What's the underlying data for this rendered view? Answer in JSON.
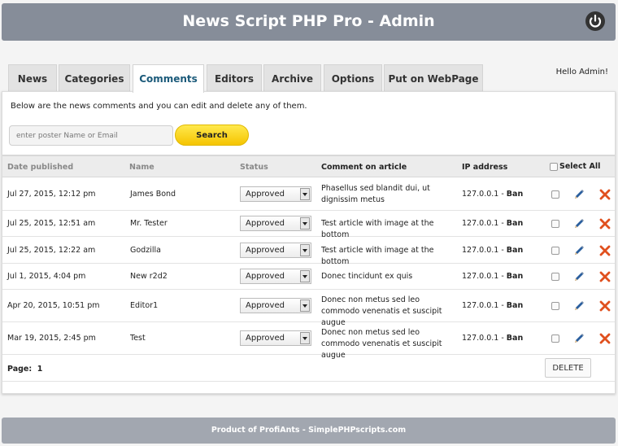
{
  "header": {
    "title": "News Script PHP Pro - Admin",
    "power_icon": "power-icon"
  },
  "tabs": [
    {
      "label": "News",
      "active": false
    },
    {
      "label": "Categories",
      "active": false
    },
    {
      "label": "Comments",
      "active": true
    },
    {
      "label": "Editors",
      "active": false
    },
    {
      "label": "Archive",
      "active": false
    },
    {
      "label": "Options",
      "active": false
    },
    {
      "label": "Put on WebPage",
      "active": false
    }
  ],
  "hello": "Hello Admin!",
  "intro": "Below are the news comments and you can edit and delete any of them.",
  "search": {
    "placeholder": "enter poster Name or Email",
    "button": "Search"
  },
  "table": {
    "headers": {
      "date": "Date published",
      "name": "Name",
      "status": "Status",
      "comment": "Comment on article",
      "ip": "IP address",
      "select_all": "Select All"
    },
    "rows": [
      {
        "date": "Jul 27, 2015, 12:12 pm",
        "name": "James Bond",
        "status": "Approved",
        "comment": "Phasellus sed blandit dui, ut dignissim metus",
        "ip": "127.0.0.1 - ",
        "ban": "Ban"
      },
      {
        "date": "Jul 25, 2015, 12:51 am",
        "name": "Mr. Tester",
        "status": "Approved",
        "comment": "Test article with image at the bottom",
        "ip": "127.0.0.1 - ",
        "ban": "Ban"
      },
      {
        "date": "Jul 25, 2015, 12:22 am",
        "name": "Godzilla",
        "status": "Approved",
        "comment": "Test article with image at the bottom",
        "ip": "127.0.0.1 - ",
        "ban": "Ban"
      },
      {
        "date": "Jul 1, 2015, 4:04 pm",
        "name": "New r2d2",
        "status": "Approved",
        "comment": "Donec tincidunt ex quis",
        "ip": "127.0.0.1 - ",
        "ban": "Ban"
      },
      {
        "date": "Apr 20, 2015, 10:51 pm",
        "name": "Editor1",
        "status": "Approved",
        "comment": "Donec non metus sed leo commodo venenatis et suscipit augue",
        "ip": "127.0.0.1 - ",
        "ban": "Ban"
      },
      {
        "date": "Mar 19, 2015, 2:45 pm",
        "name": "Test",
        "status": "Approved",
        "comment": "Donec non metus sed leo commodo venenatis et suscipit augue",
        "ip": "127.0.0.1 - ",
        "ban": "Ban"
      }
    ]
  },
  "pagination": {
    "label": "Page:",
    "value": "1"
  },
  "delete_button": "DELETE",
  "footer": "Product of ProfiAnts - SimplePHPscripts.com",
  "colors": {
    "header": "#868d99",
    "footer": "#a2a7b0",
    "active_tab_text": "#1b5a7a",
    "search_button": "#f5c400",
    "delete_icon": "#e0501e",
    "edit_icon": "#2b5f9e"
  }
}
